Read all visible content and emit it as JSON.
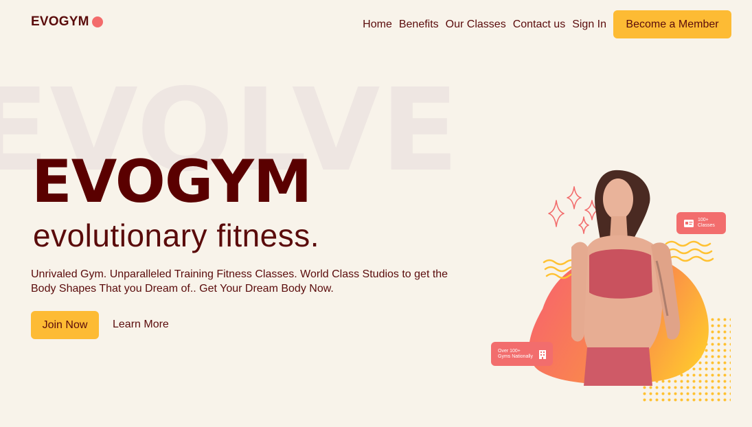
{
  "brand": {
    "name": "EVOGYM",
    "accent": "#f36b6b"
  },
  "nav": {
    "links": [
      "Home",
      "Benefits",
      "Our Classes",
      "Contact us",
      "Sign In"
    ],
    "cta": "Become a Member"
  },
  "hero": {
    "background_word": "EVOLVE",
    "title": "EVOGYM",
    "subtitle": "evolutionary fitness.",
    "description": "Unrivaled Gym. Unparalleled Training Fitness Classes. World Class Studios to get the Body Shapes That you Dream of.. Get Your Dream Body Now.",
    "join_label": "Join Now",
    "learn_label": "Learn More"
  },
  "badges": {
    "classes": {
      "line1": "100+",
      "line2": "Classes",
      "icon": "id-card-icon"
    },
    "gyms": {
      "line1": "Over 100+",
      "line2": "Gyms Nationally",
      "icon": "building-icon"
    }
  },
  "colors": {
    "background": "#f8f3ea",
    "primary_text": "#5a0b0b",
    "button": "#fdbb34",
    "badge": "#f26d6d"
  }
}
